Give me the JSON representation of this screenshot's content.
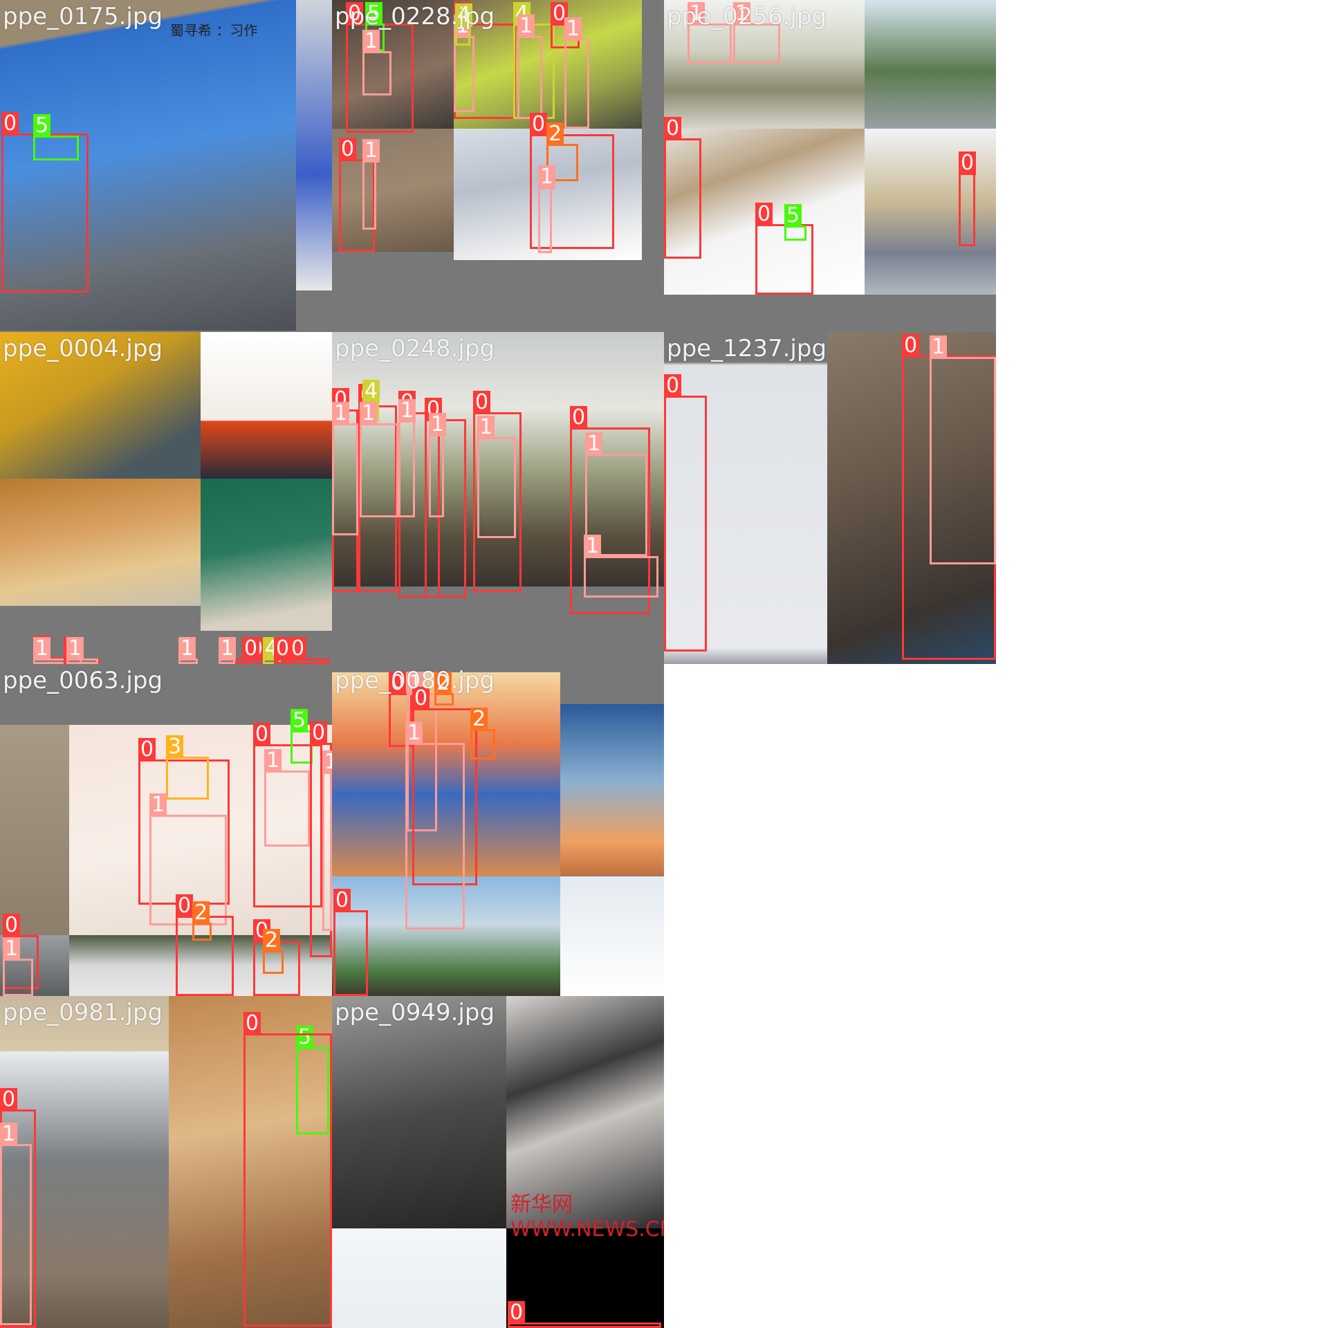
{
  "grid": {
    "background": "#ffffff",
    "tile_background": "#787878"
  },
  "class_colors": {
    "0": "#ff3838",
    "1": "#ff9d97",
    "2": "#ff701f",
    "3": "#ffb21d",
    "4": "#cfd231",
    "5": "#48f90a"
  },
  "tiles": [
    {
      "name": "ppe_0175.jpg",
      "title": "ppe_0175.jpg",
      "watermark": "蜀寻希 ：习作",
      "boxes": [
        {
          "label": "0"
        },
        {
          "label": "5"
        }
      ]
    },
    {
      "name": "ppe_0228.jpg",
      "title": "ppe_0228.jpg",
      "boxes": [
        {
          "label": "0"
        },
        {
          "label": "5"
        },
        {
          "label": "1"
        },
        {
          "label": "0"
        },
        {
          "label": "1"
        },
        {
          "label": "4"
        },
        {
          "label": "4"
        },
        {
          "label": "1"
        },
        {
          "label": "0"
        },
        {
          "label": "1"
        },
        {
          "label": "0"
        },
        {
          "label": "2"
        },
        {
          "label": "1"
        },
        {
          "label": "0"
        },
        {
          "label": "1"
        }
      ]
    },
    {
      "name": "ppe_0256.jpg",
      "title": "ppe_0256.jpg",
      "boxes": [
        {
          "label": "1"
        },
        {
          "label": "1"
        },
        {
          "label": "0"
        },
        {
          "label": "0"
        },
        {
          "label": "5"
        },
        {
          "label": "0"
        }
      ]
    },
    {
      "name": "ppe_0004.jpg",
      "title": "ppe_0004.jpg",
      "boxes": [
        {
          "label": "0"
        },
        {
          "label": "1"
        },
        {
          "label": "1"
        },
        {
          "label": "0"
        },
        {
          "label": "0"
        },
        {
          "label": "1"
        },
        {
          "label": "0"
        },
        {
          "label": "1"
        },
        {
          "label": "0"
        },
        {
          "label": "4"
        },
        {
          "label": "0"
        },
        {
          "label": "0"
        }
      ]
    },
    {
      "name": "ppe_0248.jpg",
      "title": "ppe_0248.jpg",
      "boxes": [
        {
          "label": "0"
        },
        {
          "label": "1"
        },
        {
          "label": "0"
        },
        {
          "label": "4"
        },
        {
          "label": "1"
        },
        {
          "label": "0"
        },
        {
          "label": "1"
        },
        {
          "label": "0"
        },
        {
          "label": "1"
        },
        {
          "label": "0"
        },
        {
          "label": "1"
        },
        {
          "label": "0"
        },
        {
          "label": "1"
        },
        {
          "label": "1"
        }
      ]
    },
    {
      "name": "ppe_1237.jpg",
      "title": "ppe_1237.jpg",
      "boxes": [
        {
          "label": "0"
        },
        {
          "label": "0"
        },
        {
          "label": "1"
        }
      ]
    },
    {
      "name": "ppe_0063.jpg",
      "title": "ppe_0063.jpg",
      "boxes": [
        {
          "label": "0"
        },
        {
          "label": "3"
        },
        {
          "label": "1"
        },
        {
          "label": "0"
        },
        {
          "label": "5"
        },
        {
          "label": "0"
        },
        {
          "label": "1"
        },
        {
          "label": "1"
        },
        {
          "label": "0"
        },
        {
          "label": "1"
        },
        {
          "label": "0"
        },
        {
          "label": "2"
        },
        {
          "label": "0"
        },
        {
          "label": "2"
        }
      ]
    },
    {
      "name": "ppe_0080.jpg",
      "title": "ppe_0080.jpg",
      "boxes": [
        {
          "label": "0"
        },
        {
          "label": "1"
        },
        {
          "label": "2"
        },
        {
          "label": "0"
        },
        {
          "label": "2"
        },
        {
          "label": "1"
        },
        {
          "label": "0"
        }
      ]
    },
    {
      "name": "ppe_0981.jpg",
      "title": "ppe_0981.jpg",
      "boxes": [
        {
          "label": "0"
        },
        {
          "label": "5"
        },
        {
          "label": "0"
        },
        {
          "label": "1"
        }
      ]
    },
    {
      "name": "ppe_0949.jpg",
      "title": "ppe_0949.jpg",
      "watermark": "新华网 WWW.NEWS.CN",
      "boxes": [
        {
          "label": "0"
        }
      ]
    }
  ]
}
